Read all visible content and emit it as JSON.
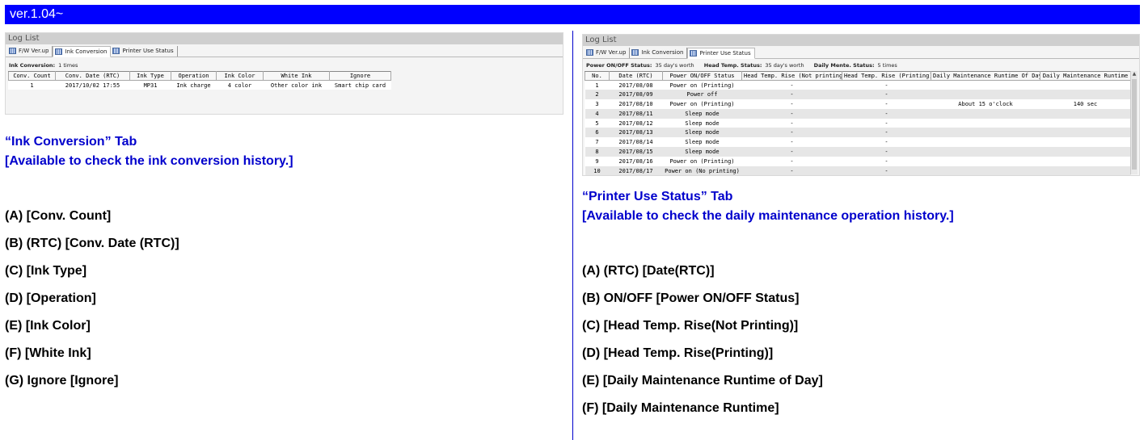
{
  "banner": "ver.1.04~",
  "left": {
    "panel_title": "Log List",
    "tabs": [
      {
        "label": "F/W Ver.up",
        "active": false
      },
      {
        "label": "Ink Conversion",
        "active": true
      },
      {
        "label": "Printer Use Status",
        "active": false
      }
    ],
    "status": {
      "label": "Ink Conversion:",
      "value": "1 times"
    },
    "table": {
      "columns": [
        "Conv. Count",
        "Conv. Date (RTC)",
        "Ink Type",
        "Operation",
        "Ink Color",
        "White Ink",
        "Ignore"
      ],
      "rows": [
        [
          "1",
          "2017/10/02 17:55",
          "MP31",
          "Ink charge",
          "4 color",
          "Other color ink",
          "Smart chip card"
        ]
      ]
    },
    "heading_line1": "“Ink Conversion” Tab",
    "heading_line2": "[Available to check the ink conversion history.]",
    "items": [
      "(A)  [Conv. Count]",
      "(B)  (RTC) [Conv. Date (RTC)]",
      "(C)  [Ink Type]",
      "(D)  [Operation]",
      "(E)  [Ink Color]",
      "(F)  [White Ink]",
      "(G)  Ignore [Ignore]"
    ]
  },
  "right": {
    "panel_title": "Log List",
    "tabs": [
      {
        "label": "F/W Ver.up",
        "active": false
      },
      {
        "label": "Ink Conversion",
        "active": false
      },
      {
        "label": "Printer Use Status",
        "active": true
      }
    ],
    "status": [
      {
        "label": "Power ON/OFF Status:",
        "value": "35 day's worth"
      },
      {
        "label": "Head Temp. Status:",
        "value": "35 day's worth"
      },
      {
        "label": "Daily Mente. Status:",
        "value": "5 times"
      }
    ],
    "table": {
      "columns": [
        "No.",
        "Date (RTC)",
        "Power ON/OFF Status",
        "Head Temp. Rise (Not printing)",
        "Head Temp. Rise (Printing)",
        "Daily Maintenance Runtime Of Day",
        "Daily Maintenance Runtime"
      ],
      "rows": [
        [
          "1",
          "2017/08/08",
          "Power on (Printing)",
          "-",
          "-",
          "",
          ""
        ],
        [
          "2",
          "2017/08/09",
          "Power off",
          "-",
          "-",
          "",
          ""
        ],
        [
          "3",
          "2017/08/10",
          "Power on (Printing)",
          "-",
          "-",
          "About 15 o'clock",
          "140 sec"
        ],
        [
          "4",
          "2017/08/11",
          "Sleep mode",
          "-",
          "-",
          "",
          ""
        ],
        [
          "5",
          "2017/08/12",
          "Sleep mode",
          "-",
          "-",
          "",
          ""
        ],
        [
          "6",
          "2017/08/13",
          "Sleep mode",
          "-",
          "-",
          "",
          ""
        ],
        [
          "7",
          "2017/08/14",
          "Sleep mode",
          "-",
          "-",
          "",
          ""
        ],
        [
          "8",
          "2017/08/15",
          "Sleep mode",
          "-",
          "-",
          "",
          ""
        ],
        [
          "9",
          "2017/08/16",
          "Power on (Printing)",
          "-",
          "-",
          "",
          ""
        ],
        [
          "10",
          "2017/08/17",
          "Power on (No printing)",
          "-",
          "-",
          "",
          ""
        ]
      ]
    },
    "heading_line1": "“Printer Use Status” Tab",
    "heading_line2": "[Available to check the daily maintenance operation history.]",
    "items": [
      "(A)  (RTC) [Date(RTC)]",
      "(B)  ON/OFF [Power ON/OFF Status]",
      "(C)  [Head Temp. Rise(Not Printing)]",
      "(D)  [Head Temp. Rise(Printing)]",
      "(E)  [Daily Maintenance Runtime of Day]",
      "(F)  [Daily Maintenance Runtime]"
    ]
  },
  "colors": {
    "banner": "#0000ff",
    "heading": "#0000cc"
  }
}
